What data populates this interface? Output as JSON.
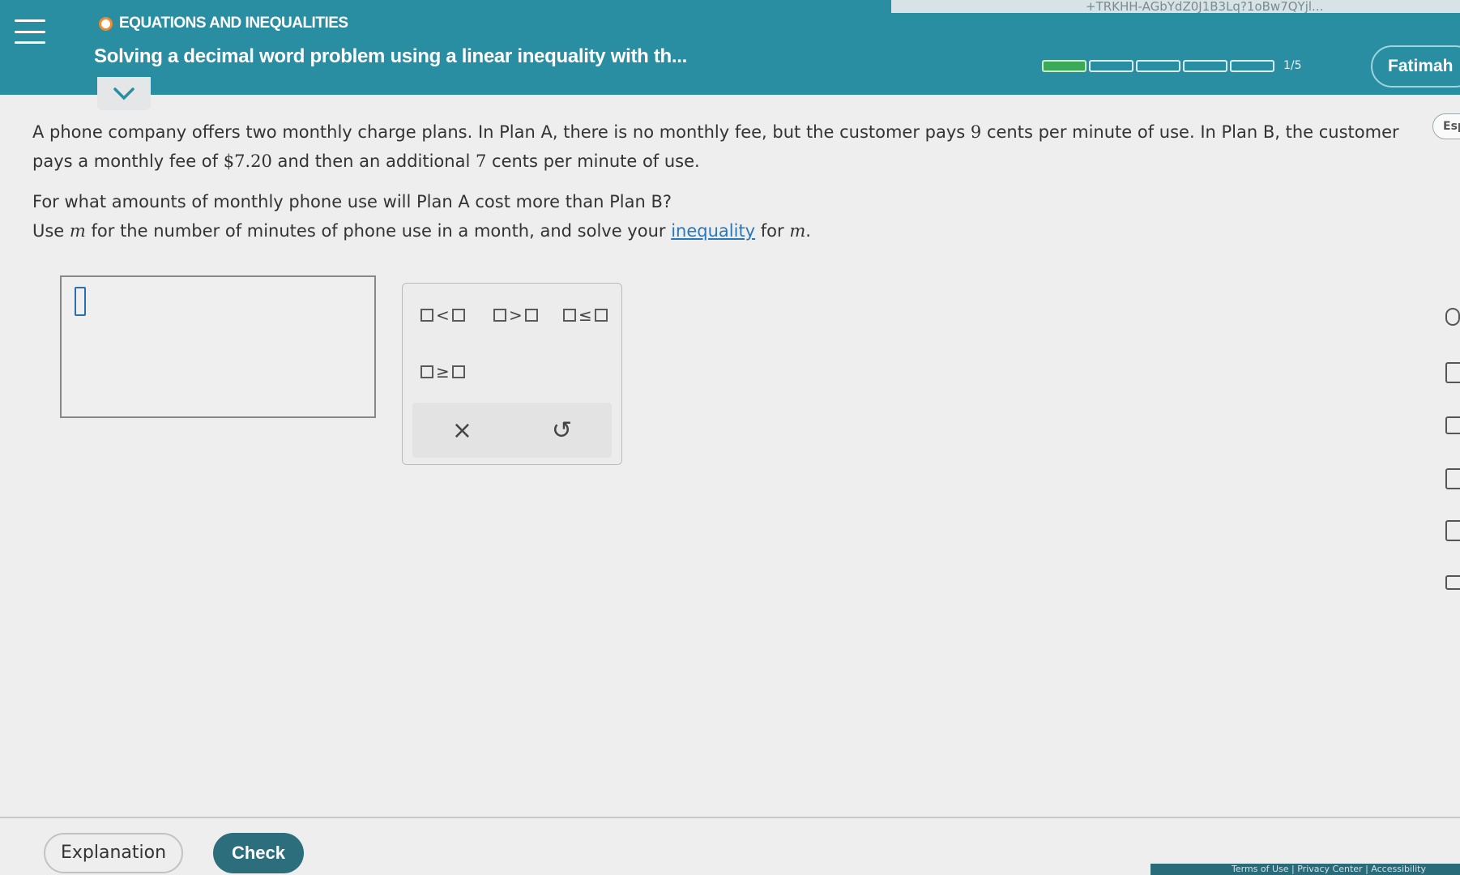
{
  "browser": {
    "url_fragment": "+TRKHH-AGbYdZ0J1B3Lq?1oBw7QYjl..."
  },
  "header": {
    "topic": "EQUATIONS AND INEQUALITIES",
    "title": "Solving a decimal word problem using a linear inequality with th...",
    "progress": {
      "current": 1,
      "total": 5,
      "label": "1/5"
    },
    "user_name": "Fatimah",
    "language_button": "Esp"
  },
  "question": {
    "p1_a": "A phone company offers two monthly charge plans. In Plan A, there is no monthly fee, but the customer pays ",
    "p1_num1": "9",
    "p1_b": " cents per minute of use. In Plan B, the customer pays a monthly fee of ",
    "p1_num2": "$7.20",
    "p1_c": " and then an additional ",
    "p1_num3": "7",
    "p1_d": " cents per minute of use.",
    "p2": "For what amounts of monthly phone use will Plan A cost more than Plan B?",
    "p3_a": "Use ",
    "var": "m",
    "p3_b": " for the number of minutes of phone use in a month, and solve your ",
    "link": "inequality",
    "p3_c": " for ",
    "p3_d": "."
  },
  "keypad": {
    "lt": "<",
    "gt": ">",
    "le": "≤",
    "ge": "≥",
    "clear": "×",
    "undo": "↺"
  },
  "sidebar_icons": [
    "book-icon",
    "calculator-icon",
    "video-icon",
    "reference-icon",
    "glossary-icon",
    "mail-icon"
  ],
  "footer": {
    "explanation": "Explanation",
    "check": "Check",
    "links": "Terms of Use | Privacy Center | Accessibility"
  },
  "colors": {
    "header": "#2a8ea3",
    "progress_fill": "#3ba957",
    "check_button": "#2c6e7c",
    "topic_dot": "#f08a2c",
    "link": "#2a78b8"
  }
}
